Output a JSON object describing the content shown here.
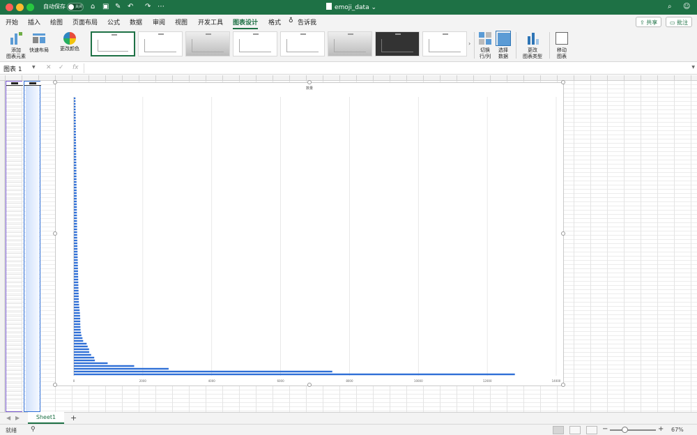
{
  "window": {
    "autosave_label": "自动保存",
    "autosave_state": "关闭",
    "doc_title": "emoji_data"
  },
  "ribbon_tabs": [
    {
      "label": "开始"
    },
    {
      "label": "插入"
    },
    {
      "label": "绘图"
    },
    {
      "label": "页面布局"
    },
    {
      "label": "公式"
    },
    {
      "label": "数据"
    },
    {
      "label": "审阅"
    },
    {
      "label": "视图"
    },
    {
      "label": "开发工具"
    },
    {
      "label": "图表设计"
    },
    {
      "label": "格式"
    }
  ],
  "tell_me": "告诉我",
  "share_label": "共享",
  "comment_label": "批注",
  "ribbon": {
    "add_element": "添加\n图表元素",
    "quick_layout": "快速布局",
    "change_colors": "更改颜色",
    "switch_row_col": "切换\n行/列",
    "select_data": "选择\n数据",
    "change_type": "更改\n图表类型",
    "move_chart": "移动\n图表"
  },
  "formula_bar": {
    "name_box": "图表 1",
    "formula": ""
  },
  "sheet_tabs": [
    {
      "label": "Sheet1"
    }
  ],
  "status": {
    "ready": "就绪",
    "zoom": "67%",
    "zoom_level": 0.67
  },
  "colors": {
    "brand": "#1e7145",
    "bar": "#2f6fd6"
  },
  "chart_data": {
    "type": "bar",
    "orientation": "horizontal",
    "title": "数量",
    "xlim": [
      0,
      14000
    ],
    "x_ticks": [
      "0",
      "2000",
      "4000",
      "6000",
      "8000",
      "10000",
      "12000",
      "14000"
    ],
    "grid": true,
    "legend": "none",
    "values": [
      12800,
      7500,
      2750,
      1750,
      980,
      610,
      590,
      500,
      446,
      440,
      400,
      370,
      270,
      249,
      220,
      206,
      194,
      190,
      186,
      185,
      184,
      180,
      175,
      166,
      158,
      150,
      145,
      142,
      140,
      138,
      135,
      133,
      130,
      128,
      126,
      124,
      122,
      120,
      118,
      116,
      114,
      112,
      110,
      108,
      106,
      104,
      102,
      100,
      98,
      96,
      95,
      94,
      93,
      92,
      91,
      90,
      89,
      88,
      87,
      86,
      85,
      84,
      83,
      82,
      81,
      80,
      79,
      78,
      77,
      76,
      75,
      74,
      73,
      72,
      71,
      70,
      69,
      68,
      67,
      66,
      65,
      64,
      63,
      62,
      61,
      60,
      59,
      58,
      57,
      56,
      55,
      54,
      53,
      52,
      51,
      50,
      49,
      48,
      47,
      46
    ]
  }
}
